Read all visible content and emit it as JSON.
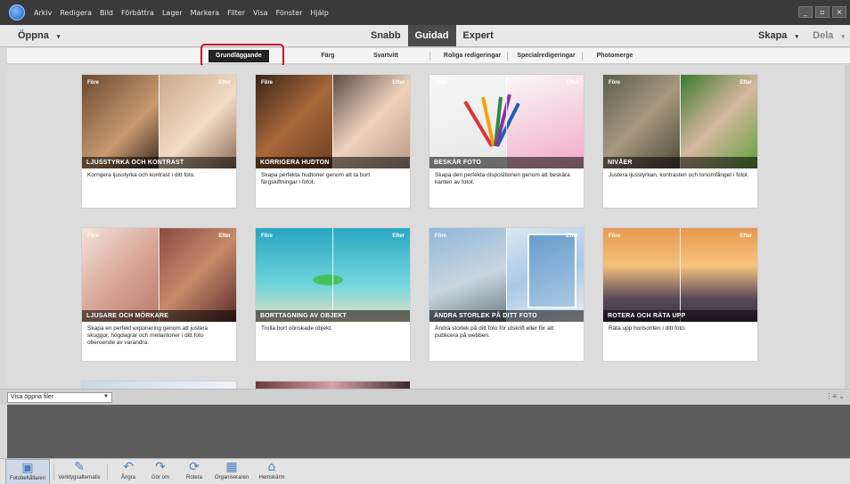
{
  "menubar": {
    "items": [
      "Arkiv",
      "Redigera",
      "Bild",
      "Förbättra",
      "Lager",
      "Markera",
      "Filter",
      "Visa",
      "Fönster",
      "Hjälp"
    ],
    "window_controls": [
      "_",
      "▫",
      "×"
    ]
  },
  "modebar": {
    "open_label": "Öppna",
    "tabs": [
      "Snabb",
      "Guidad",
      "Expert"
    ],
    "active_tab": "Guidad",
    "create_label": "Skapa",
    "share_label": "Dela"
  },
  "categories": [
    "Grundläggande",
    "Färg",
    "Svartvitt",
    "Roliga redigeringar",
    "Specialredigeringar",
    "Photomerge"
  ],
  "active_category": "Grundläggande",
  "cards": [
    {
      "title": "LJUSSTYRKA OCH KONTRAST",
      "desc": "Korrigera ljusstyrka och kontrast i ditt foto.",
      "before": "Före",
      "after": "Efter",
      "colors": [
        "#b8835d",
        "#e8c9a4"
      ]
    },
    {
      "title": "KORRIGERA HUDTON",
      "desc": "Skapa perfekta hudtoner genom att ta bort färgskiftningar i fotot.",
      "before": "Före",
      "after": "Efter",
      "colors": [
        "#a87040",
        "#e7c3a6"
      ]
    },
    {
      "title": "BESKÄR FOTO",
      "desc": "Skapa den perfekta dispositionen genom att beskära kanten av fotot.",
      "before": "Före",
      "after": "Efter",
      "colors": [
        "#f2f2f2",
        "#f0b7cd"
      ]
    },
    {
      "title": "NIVÅER",
      "desc": "Justera ljusstyrkan, kontrasten och tonomfånget i fotot.",
      "before": "Före",
      "after": "Efter",
      "colors": [
        "#7a8a5a",
        "#5f9a3c"
      ]
    },
    {
      "title": "LJUSARE OCH MÖRKARE",
      "desc": "Skapa en perfekt exponering genom att justera skuggor, högdagrar och mellantoner i ditt foto oberoende av varandra.",
      "before": "Före",
      "after": "Efter",
      "colors": [
        "#e9cfc4",
        "#8b4f4a"
      ]
    },
    {
      "title": "BORTTAGNING AV OBJEKT",
      "desc": "Trolla bort oönskade objekt.",
      "before": "Före",
      "after": "Efter",
      "colors": [
        "#3fb5c8",
        "#66c8d2"
      ]
    },
    {
      "title": "ÄNDRA STORLEK PÅ DITT FOTO",
      "desc": "Ändra storlek på ditt foto för utskrift eller för att publicera på webben.",
      "before": "Före",
      "after": "Efter",
      "colors": [
        "#6e9ac2",
        "#8fb7de"
      ]
    },
    {
      "title": "ROTERA OCH RÄTA UPP",
      "desc": "Räta upp horisonten i ditt foto.",
      "before": "Före",
      "after": "Efter",
      "colors": [
        "#d99050",
        "#6a5a6a"
      ]
    }
  ],
  "filebar": {
    "select_value": "Visa öppna filer"
  },
  "bottom_tools": [
    {
      "label": "Fotobehållaren",
      "icon": "▣"
    },
    {
      "label": "Verktygsalternativ",
      "icon": "✎"
    },
    {
      "label": "Ångra",
      "icon": "↶"
    },
    {
      "label": "Gör om",
      "icon": "↷"
    },
    {
      "label": "Rotera",
      "icon": "⟳"
    },
    {
      "label": "Organiseraren",
      "icon": "▦"
    },
    {
      "label": "Hemskärm",
      "icon": "⌂"
    }
  ]
}
